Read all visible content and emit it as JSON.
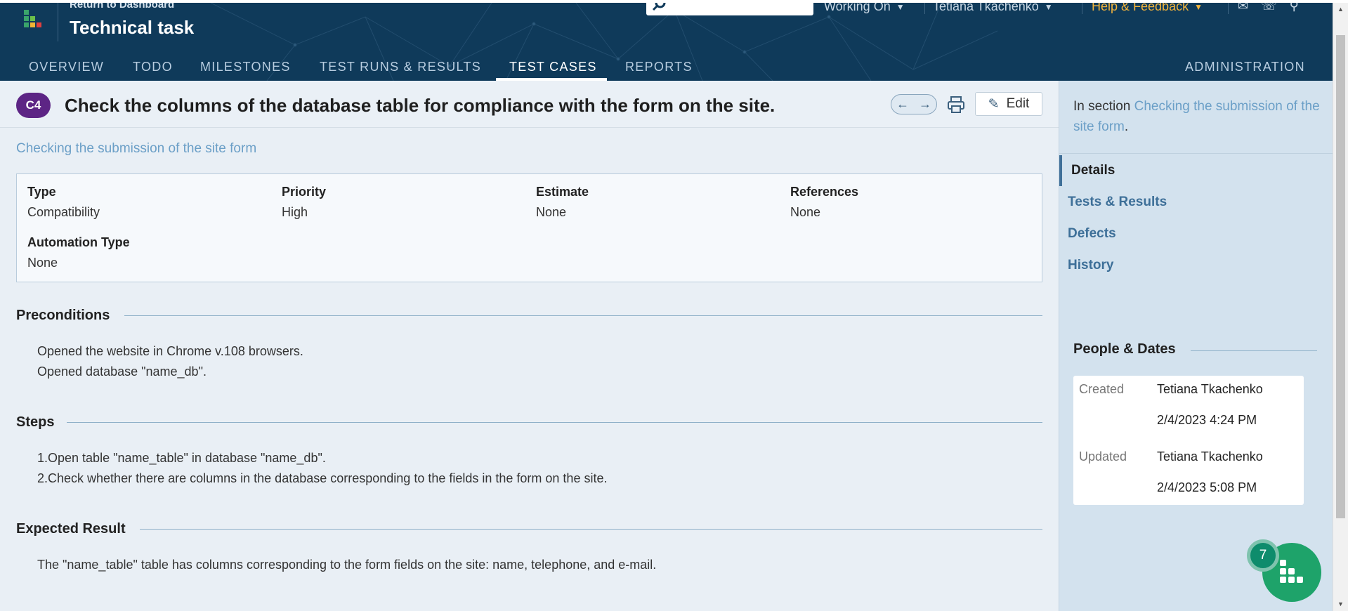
{
  "header": {
    "return_link": "Return to Dashboard",
    "project_title": "Technical task",
    "search_placeholder": "",
    "working_on": "Working On",
    "user_menu": "Tetiana Tkachenko",
    "help_menu": "Help & Feedback",
    "colors": {
      "background": "#0f3a5a",
      "help": "#f3b43c"
    }
  },
  "nav": {
    "items": [
      "OVERVIEW",
      "TODO",
      "MILESTONES",
      "TEST RUNS & RESULTS",
      "TEST CASES",
      "REPORTS"
    ],
    "active": "TEST CASES",
    "admin": "ADMINISTRATION"
  },
  "case": {
    "id": "C4",
    "title": "Check the columns of the database table for compliance with the form on the site.",
    "edit_label": "Edit",
    "section_link": "Checking the submission of the site form",
    "fields": {
      "type_label": "Type",
      "type_value": "Compatibility",
      "priority_label": "Priority",
      "priority_value": "High",
      "estimate_label": "Estimate",
      "estimate_value": "None",
      "references_label": "References",
      "references_value": "None",
      "automation_label": "Automation Type",
      "automation_value": "None"
    },
    "preconditions": {
      "heading": "Preconditions",
      "lines": [
        "Opened the website in Chrome v.108 browsers.",
        "Opened database \"name_db\"."
      ]
    },
    "steps": {
      "heading": "Steps",
      "lines": [
        "1.Open table \"name_table\" in database \"name_db\".",
        "2.Check whether there are columns in the database corresponding to the fields in the form on the site."
      ]
    },
    "expected": {
      "heading": "Expected Result",
      "lines": [
        "The \"name_table\" table has columns corresponding to the form fields on the site: name, telephone, and e-mail."
      ]
    }
  },
  "sidebar": {
    "in_section_prefix": "In section ",
    "in_section_link": "Checking the submission of the site form",
    "in_section_suffix": ".",
    "nav": [
      "Details",
      "Tests & Results",
      "Defects",
      "History"
    ],
    "active_nav": "Details",
    "people_dates": {
      "heading": "People & Dates",
      "created_label": "Created",
      "created_by": "Tetiana Tkachenko",
      "created_at": "2/4/2023 4:24 PM",
      "updated_label": "Updated",
      "updated_by": "Tetiana Tkachenko",
      "updated_at": "2/4/2023 5:08 PM"
    }
  },
  "widget": {
    "badge_count": "7"
  }
}
